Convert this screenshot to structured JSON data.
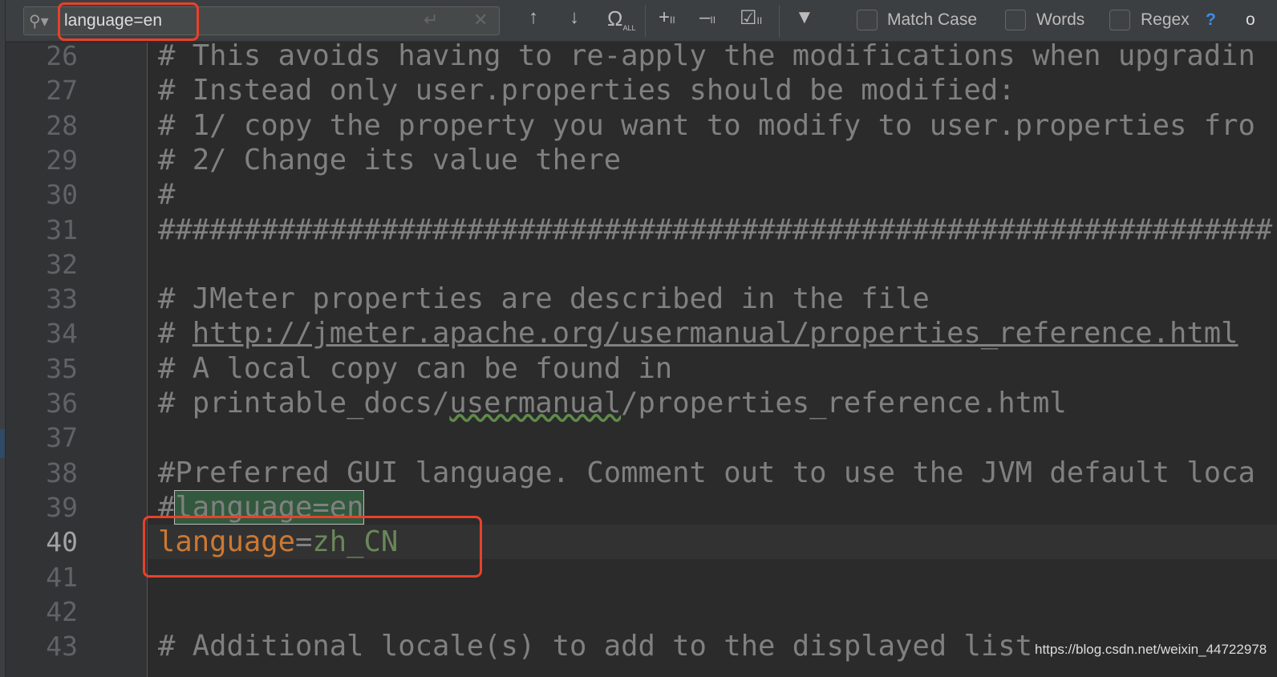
{
  "find_bar": {
    "search_value": "language=en",
    "icons": [
      "search-icon",
      "enter-icon",
      "clear-icon",
      "arrow-up-icon",
      "arrow-down-icon",
      "select-all-occurrences-icon",
      "add-selection-icon",
      "remove-selection-icon",
      "toggle-selection-icon",
      "filter-icon",
      "help-icon"
    ],
    "select_all_label": "ALL",
    "options": [
      {
        "label": "Match Case",
        "checked": false
      },
      {
        "label": "Words",
        "checked": false
      },
      {
        "label": "Regex",
        "checked": false
      }
    ],
    "help": "?",
    "cut_off_text": "o"
  },
  "editor": {
    "current_line": 40,
    "lines": [
      {
        "n": "26",
        "text": "# This avoids having to re-apply the modifications when upgradin"
      },
      {
        "n": "27",
        "text": "# Instead only user.properties should be modified:"
      },
      {
        "n": "28",
        "text": "# 1/ copy the property you want to modify to user.properties fro"
      },
      {
        "n": "29",
        "text": "# 2/ Change its value there"
      },
      {
        "n": "30",
        "text": "#"
      },
      {
        "n": "31",
        "text": "#################################################################"
      },
      {
        "n": "32",
        "text": ""
      },
      {
        "n": "33",
        "text": "# JMeter properties are described in the file"
      },
      {
        "n": "34",
        "prefix": "# ",
        "link": "http://jmeter.apache.org/usermanual/properties_reference.html"
      },
      {
        "n": "35",
        "text": "# A local copy can be found in"
      },
      {
        "n": "36",
        "prefix": "# printable_docs/",
        "squiggle": "usermanual",
        "suffix": "/properties_reference.html"
      },
      {
        "n": "37",
        "text": ""
      },
      {
        "n": "38",
        "text": "#Preferred GUI language. Comment out to use the JVM default loca"
      },
      {
        "n": "39",
        "prefix": "#",
        "match": "language=en"
      },
      {
        "n": "40",
        "key": "language",
        "eq": "=",
        "value": "zh_CN"
      },
      {
        "n": "41",
        "text": ""
      },
      {
        "n": "42",
        "text": ""
      },
      {
        "n": "43",
        "text": "# Additional locale(s) to add to the displayed list"
      }
    ]
  },
  "watermark": "https://blog.csdn.net/weixin_44722978",
  "colors": {
    "highlight_box": "#e8412b",
    "key": "#cc7832",
    "value": "#6a8759",
    "comment": "#808080",
    "match_bg": "#32593d"
  }
}
